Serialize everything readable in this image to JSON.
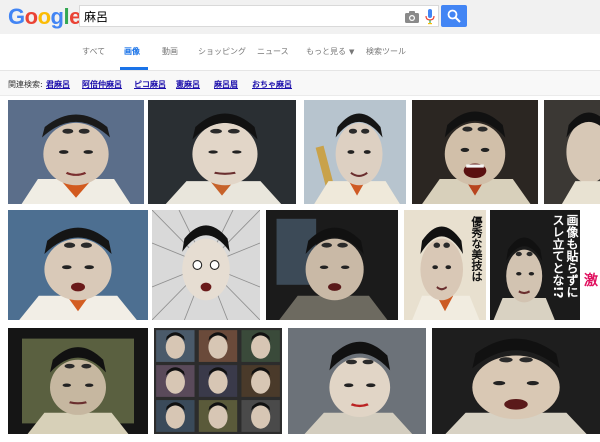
{
  "logo": {
    "letters": [
      "G",
      "o",
      "o",
      "g",
      "l",
      "e"
    ],
    "colors": [
      "#4285f4",
      "#ea4335",
      "#fbbc05",
      "#4285f4",
      "#34a853",
      "#ea4335"
    ]
  },
  "search": {
    "query": "麻呂"
  },
  "tabs": [
    {
      "label": "すべて"
    },
    {
      "label": "画像"
    },
    {
      "label": "動画"
    },
    {
      "label": "ショッピング"
    },
    {
      "label": "ニュース"
    },
    {
      "label": "もっと見る"
    },
    {
      "label": "検索ツール"
    }
  ],
  "related": {
    "label": "関連検索:",
    "links": [
      "君麻呂",
      "阿倍仲麻呂",
      "ピコ麻呂",
      "憲麻呂",
      "麻呂眉",
      "おちゃ麻呂"
    ]
  },
  "overlay_text": {
    "col1": "優秀な美技は",
    "col2a": "画像も貼らずに",
    "col2b": "スレ立てとな!?",
    "edge": "激"
  },
  "colors": {
    "accent": "#4285f4",
    "link": "#1a0dab",
    "active_tab": "#1a73e8"
  }
}
